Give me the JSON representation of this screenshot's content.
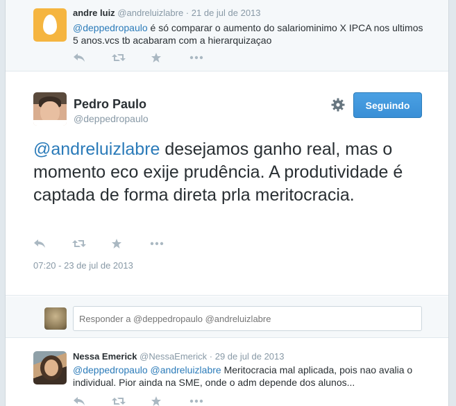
{
  "ancestor_tweet": {
    "name": "andre luiz",
    "handle": "@andreluizlabre",
    "separator": "·",
    "time": "21 de jul de 2013",
    "mention": "@deppedropaulo",
    "text": " é só comparar o aumento do salariominimo X IPCA nos ultimos 5 anos.vcs tb acabaram com a hierarquizaçao"
  },
  "main_tweet": {
    "name": "Pedro Paulo",
    "handle": "@deppedropaulo",
    "follow_label": "Seguindo",
    "mention": "@andreluizlabre",
    "text": " desejamos ganho real, mas o momento eco exije prudência. A produtividade é captada de forma direta prla meritocracia.",
    "timestamp": "07:20 - 23 de jul de 2013"
  },
  "reply_box": {
    "placeholder": "Responder a @deppedropaulo @andreluizlabre"
  },
  "reply_tweet": {
    "name": "Nessa Emerick",
    "handle": "@NessaEmerick",
    "separator": "·",
    "time": "29 de jul de 2013",
    "mention1": "@deppedropaulo",
    "mention2": "@andreluizlabre",
    "text": " Meritocracia mal aplicada, pois nao avalia o individual. Pior ainda na SME, onde o adm depende dos alunos..."
  },
  "icons": [
    "reply-icon",
    "retweet-icon",
    "favorite-icon",
    "more-icon",
    "gear-icon",
    "egg-avatar"
  ],
  "colors": {
    "accent": "#2b7bb9",
    "follow_button": "#4aa0e3",
    "muted": "#8899a6",
    "egg_avatar": "#f5b540"
  }
}
